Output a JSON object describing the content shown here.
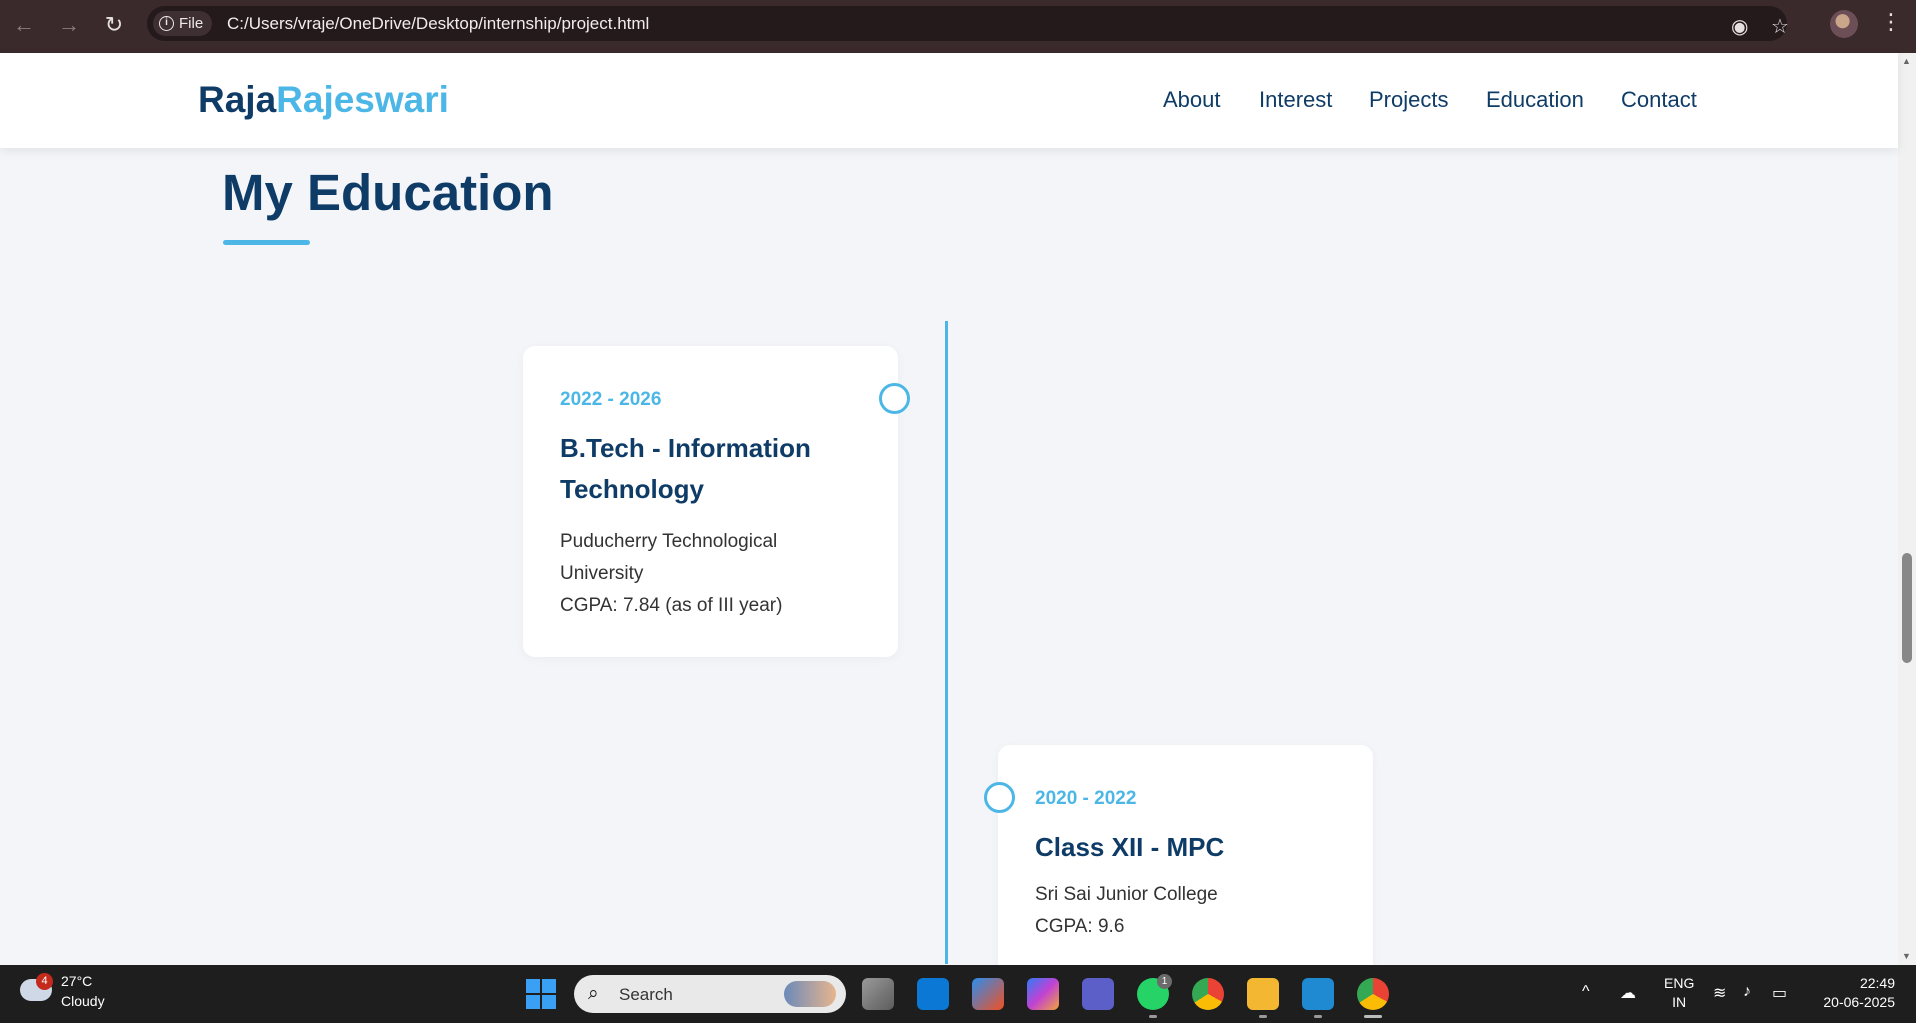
{
  "browser": {
    "url": "C:/Users/vraje/OneDrive/Desktop/internship/project.html",
    "file_chip": "File",
    "back_icon": "←",
    "forward_icon": "→",
    "reload_icon": "↻",
    "eye_icon": "◉",
    "star_icon": "☆",
    "menu_icon": "⋮"
  },
  "header": {
    "logo_first": "Raja",
    "logo_second": "Rajeswari",
    "nav": [
      "About",
      "Interest",
      "Projects",
      "Education",
      "Contact"
    ]
  },
  "section": {
    "title": "My Education"
  },
  "timeline": [
    {
      "years": "2022 - 2026",
      "degree": "B.Tech - Information Technology",
      "institution": "Puducherry Technological University",
      "score": "CGPA: 7.84 (as of III year)"
    },
    {
      "years": "2020 - 2022",
      "degree": "Class XII - MPC",
      "institution": "Sri Sai Junior College",
      "score": "CGPA: 9.6"
    }
  ],
  "taskbar": {
    "weather_badge": "4",
    "temperature": "27°C",
    "condition": "Cloudy",
    "search_label": "Search",
    "search_icon": "⌕",
    "lang_top": "ENG",
    "lang_bottom": "IN",
    "time": "22:49",
    "date": "20-06-2025",
    "whatsapp_badge": "1",
    "chevron_icon": "^"
  },
  "colors": {
    "navy": "#0f3c67",
    "accent": "#4cb7e6",
    "page_bg": "#f3f5f9"
  }
}
